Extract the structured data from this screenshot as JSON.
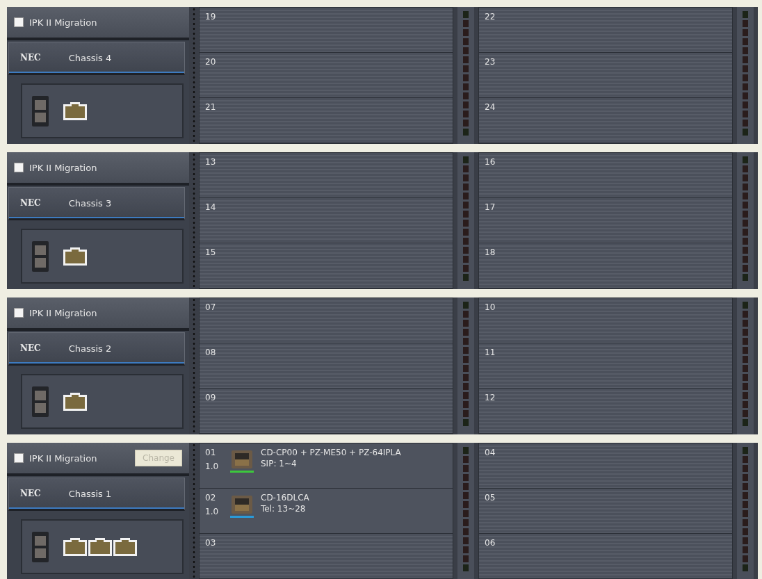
{
  "chassis": [
    {
      "migration": {
        "label": "IPK II Migration",
        "checked": false
      },
      "brand": "NEC",
      "name": "Chassis 4",
      "lan_ports": [
        {
          "kind": "rj45"
        }
      ],
      "left_slots": [
        {
          "number": "19"
        },
        {
          "number": "20"
        },
        {
          "number": "21"
        }
      ],
      "right_slots": [
        {
          "number": "22"
        },
        {
          "number": "23"
        },
        {
          "number": "24"
        }
      ]
    },
    {
      "migration": {
        "label": "IPK II Migration",
        "checked": false
      },
      "brand": "NEC",
      "name": "Chassis 3",
      "lan_ports": [
        {
          "kind": "rj45"
        }
      ],
      "left_slots": [
        {
          "number": "13"
        },
        {
          "number": "14"
        },
        {
          "number": "15"
        }
      ],
      "right_slots": [
        {
          "number": "16"
        },
        {
          "number": "17"
        },
        {
          "number": "18"
        }
      ]
    },
    {
      "migration": {
        "label": "IPK II Migration",
        "checked": false
      },
      "brand": "NEC",
      "name": "Chassis 2",
      "lan_ports": [
        {
          "kind": "rj45"
        }
      ],
      "left_slots": [
        {
          "number": "07"
        },
        {
          "number": "08"
        },
        {
          "number": "09"
        }
      ],
      "right_slots": [
        {
          "number": "10"
        },
        {
          "number": "11"
        },
        {
          "number": "12"
        }
      ]
    },
    {
      "migration": {
        "label": "IPK II Migration",
        "checked": false
      },
      "change_button": {
        "label": "Change",
        "disabled": true
      },
      "brand": "NEC",
      "name": "Chassis 1",
      "lan_ports": [
        {
          "kind": "rj45"
        },
        {
          "kind": "rj45"
        },
        {
          "kind": "rj45"
        }
      ],
      "left_slots": [
        {
          "number": "01",
          "version": "1.0",
          "card": "CD-CP00 + PZ-ME50 + PZ-64IPLA",
          "range": "SIP: 1~4",
          "color": "#3cc83c"
        },
        {
          "number": "02",
          "version": "1.0",
          "card": "CD-16DLCA",
          "range": "Tel: 13~28",
          "color": "#2a9ad8"
        },
        {
          "number": "03"
        }
      ],
      "right_slots": [
        {
          "number": "04"
        },
        {
          "number": "05"
        },
        {
          "number": "06"
        }
      ]
    }
  ]
}
